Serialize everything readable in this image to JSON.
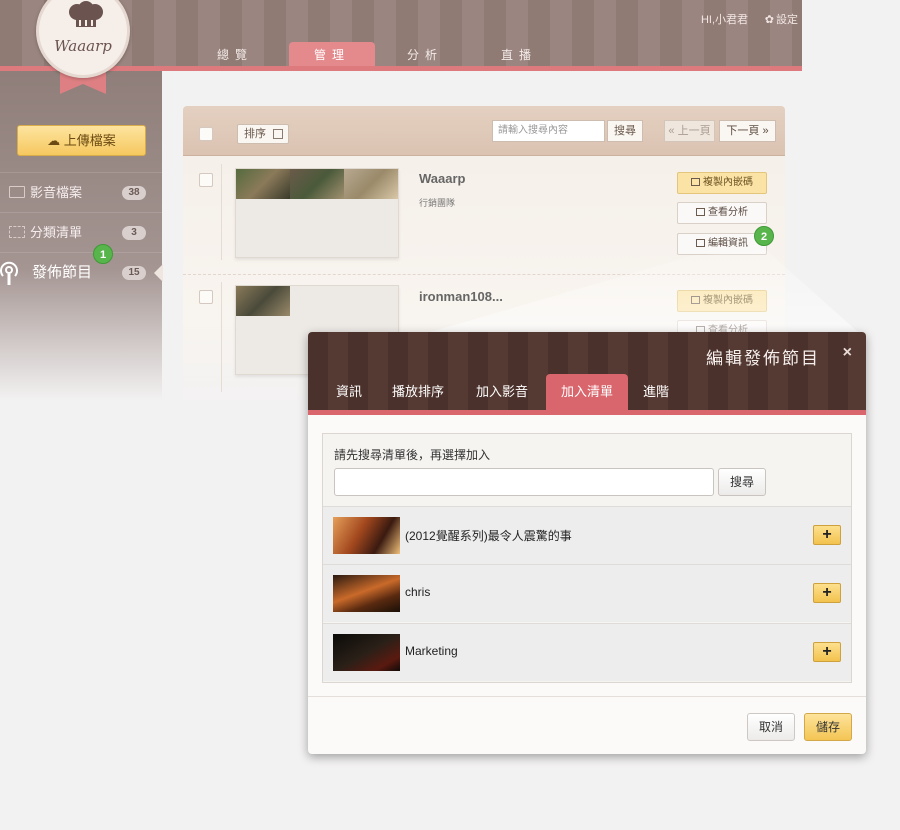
{
  "header": {
    "user_greeting": "HI,小君君",
    "settings_label": "設定",
    "tabs": [
      {
        "label": "總覽",
        "active": false
      },
      {
        "label": "管理",
        "active": true
      },
      {
        "label": "分析",
        "active": false
      },
      {
        "label": "直播",
        "active": false
      }
    ]
  },
  "logo": {
    "text": "Waaarp",
    "icon": "chef-hat-icon"
  },
  "sidebar": {
    "upload_label": "上傳檔案",
    "items": [
      {
        "label": "影音檔案",
        "count": "38",
        "icon": "film-icon"
      },
      {
        "label": "分類清單",
        "count": "3",
        "icon": "list-icon"
      },
      {
        "label": "發佈節目",
        "count": "15",
        "icon": "podcast-icon"
      }
    ]
  },
  "toolbar": {
    "sort_label": "排序",
    "search_placeholder": "請輸入搜尋內容",
    "search_label": "搜尋",
    "prev_label": "« 上一頁",
    "next_label": "下一頁 »"
  },
  "videos": [
    {
      "title": "Waaarp",
      "subtitle": "行銷團隊",
      "actions": [
        "複製內嵌碼",
        "查看分析",
        "編輯資訊"
      ]
    },
    {
      "title": "ironman108...",
      "actions": [
        "複製內嵌碼",
        "查看分析"
      ]
    }
  ],
  "markers": [
    "1",
    "2"
  ],
  "modal": {
    "title": "編輯發佈節目",
    "close": "×",
    "tabs": [
      {
        "label": "資訊",
        "active": false
      },
      {
        "label": "播放排序",
        "active": false
      },
      {
        "label": "加入影音",
        "active": false
      },
      {
        "label": "加入清單",
        "active": true
      },
      {
        "label": "進階",
        "active": false
      }
    ],
    "hint": "請先搜尋清單後，再選擇加入",
    "search_value": "",
    "search_label": "搜尋",
    "results": [
      {
        "name": "(2012覺醒系列)最令人震驚的事"
      },
      {
        "name": "chris"
      },
      {
        "name": "Marketing"
      }
    ],
    "add_symbol": "+",
    "cancel_label": "取消",
    "save_label": "儲存"
  },
  "colors": {
    "accent_pink": "#d9666c",
    "button_yellow": "#f4c554",
    "marker_green": "#58b54c",
    "header_brown": "#4b312b"
  }
}
